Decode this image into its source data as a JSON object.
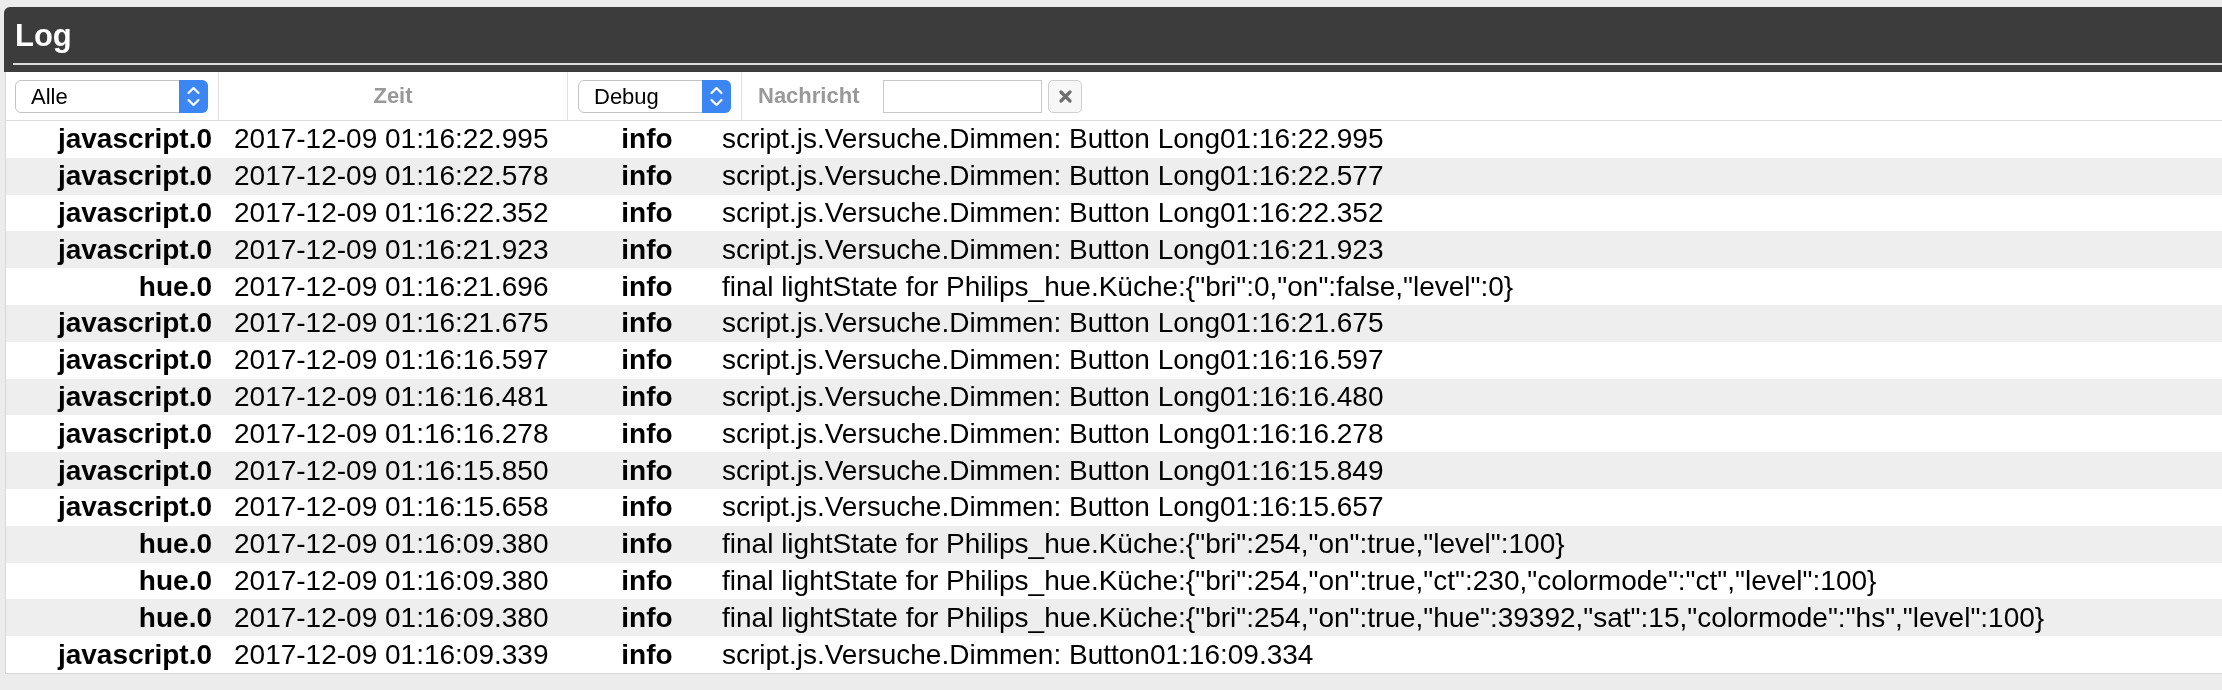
{
  "window": {
    "title": "Log"
  },
  "filters": {
    "source_select": {
      "value": "Alle"
    },
    "time_header": "Zeit",
    "level_select": {
      "value": "Debug"
    },
    "message_label": "Nachricht"
  },
  "rows": [
    {
      "source": "javascript.0",
      "time": "2017-12-09 01:16:22.995",
      "level": "info",
      "message": "script.js.Versuche.Dimmen: Button Long01:16:22.995"
    },
    {
      "source": "javascript.0",
      "time": "2017-12-09 01:16:22.578",
      "level": "info",
      "message": "script.js.Versuche.Dimmen: Button Long01:16:22.577"
    },
    {
      "source": "javascript.0",
      "time": "2017-12-09 01:16:22.352",
      "level": "info",
      "message": "script.js.Versuche.Dimmen: Button Long01:16:22.352"
    },
    {
      "source": "javascript.0",
      "time": "2017-12-09 01:16:21.923",
      "level": "info",
      "message": "script.js.Versuche.Dimmen: Button Long01:16:21.923"
    },
    {
      "source": "hue.0",
      "time": "2017-12-09 01:16:21.696",
      "level": "info",
      "message": "final lightState for Philips_hue.Küche:{\"bri\":0,\"on\":false,\"level\":0}"
    },
    {
      "source": "javascript.0",
      "time": "2017-12-09 01:16:21.675",
      "level": "info",
      "message": "script.js.Versuche.Dimmen: Button Long01:16:21.675"
    },
    {
      "source": "javascript.0",
      "time": "2017-12-09 01:16:16.597",
      "level": "info",
      "message": "script.js.Versuche.Dimmen: Button Long01:16:16.597"
    },
    {
      "source": "javascript.0",
      "time": "2017-12-09 01:16:16.481",
      "level": "info",
      "message": "script.js.Versuche.Dimmen: Button Long01:16:16.480"
    },
    {
      "source": "javascript.0",
      "time": "2017-12-09 01:16:16.278",
      "level": "info",
      "message": "script.js.Versuche.Dimmen: Button Long01:16:16.278"
    },
    {
      "source": "javascript.0",
      "time": "2017-12-09 01:16:15.850",
      "level": "info",
      "message": "script.js.Versuche.Dimmen: Button Long01:16:15.849"
    },
    {
      "source": "javascript.0",
      "time": "2017-12-09 01:16:15.658",
      "level": "info",
      "message": "script.js.Versuche.Dimmen: Button Long01:16:15.657"
    },
    {
      "source": "hue.0",
      "time": "2017-12-09 01:16:09.380",
      "level": "info",
      "message": "final lightState for Philips_hue.Küche:{\"bri\":254,\"on\":true,\"level\":100}"
    },
    {
      "source": "hue.0",
      "time": "2017-12-09 01:16:09.380",
      "level": "info",
      "message": "final lightState for Philips_hue.Küche:{\"bri\":254,\"on\":true,\"ct\":230,\"colormode\":\"ct\",\"level\":100}"
    },
    {
      "source": "hue.0",
      "time": "2017-12-09 01:16:09.380",
      "level": "info",
      "message": "final lightState for Philips_hue.Küche:{\"bri\":254,\"on\":true,\"hue\":39392,\"sat\":15,\"colormode\":\"hs\",\"level\":100}"
    },
    {
      "source": "javascript.0",
      "time": "2017-12-09 01:16:09.339",
      "level": "info",
      "message": "script.js.Versuche.Dimmen: Button01:16:09.334"
    }
  ]
}
